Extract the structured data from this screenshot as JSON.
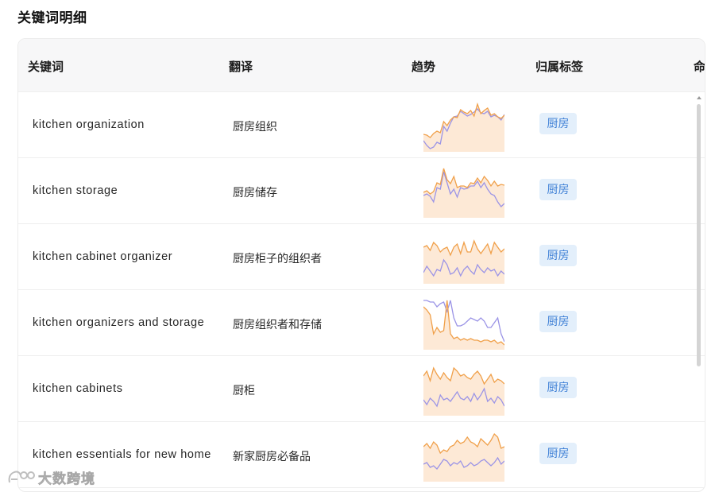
{
  "page_title": "关键词明细",
  "columns": [
    "关键词",
    "翻译",
    "趋势",
    "归属标签",
    "命"
  ],
  "rows": [
    {
      "keyword": "kitchen organization",
      "translation": "厨房组织",
      "tag": "厨房",
      "trend_orange": [
        22,
        21,
        18,
        23,
        26,
        24,
        38,
        33,
        40,
        44,
        43,
        53,
        50,
        48,
        52,
        45,
        60,
        48,
        52,
        55,
        46,
        48,
        44,
        42,
        46
      ],
      "trend_purple": [
        14,
        8,
        4,
        6,
        12,
        10,
        32,
        26,
        36,
        44,
        45,
        51,
        48,
        45,
        47,
        50,
        54,
        49,
        48,
        51,
        44,
        46,
        44,
        40,
        47
      ]
    },
    {
      "keyword": "kitchen storage",
      "translation": "厨房储存",
      "tag": "厨房",
      "trend_orange": [
        32,
        34,
        30,
        33,
        44,
        42,
        62,
        48,
        43,
        52,
        38,
        40,
        40,
        38,
        44,
        43,
        50,
        44,
        52,
        47,
        40,
        46,
        40,
        42,
        41
      ],
      "trend_purple": [
        28,
        30,
        27,
        20,
        38,
        36,
        58,
        44,
        30,
        36,
        26,
        38,
        36,
        37,
        40,
        40,
        46,
        38,
        44,
        36,
        30,
        28,
        20,
        14,
        18
      ]
    },
    {
      "keyword": "kitchen cabinet organizer",
      "translation": "厨房柜子的组织者",
      "tag": "厨房",
      "trend_orange": [
        46,
        48,
        42,
        52,
        48,
        40,
        44,
        46,
        36,
        46,
        50,
        38,
        52,
        40,
        40,
        54,
        44,
        38,
        44,
        50,
        38,
        52,
        46,
        40,
        44
      ],
      "trend_purple": [
        14,
        22,
        16,
        10,
        18,
        16,
        30,
        24,
        12,
        14,
        20,
        10,
        18,
        22,
        16,
        12,
        24,
        18,
        14,
        20,
        16,
        18,
        10,
        16,
        12
      ]
    },
    {
      "keyword": "kitchen organizers and storage",
      "translation": "厨房组织者和存储",
      "tag": "厨房",
      "trend_orange": [
        54,
        50,
        44,
        20,
        28,
        22,
        24,
        62,
        20,
        14,
        16,
        12,
        14,
        12,
        14,
        12,
        12,
        10,
        12,
        12,
        10,
        12,
        8,
        10,
        6
      ],
      "trend_purple": [
        62,
        62,
        60,
        60,
        54,
        58,
        60,
        48,
        62,
        40,
        30,
        30,
        32,
        36,
        40,
        38,
        36,
        40,
        36,
        28,
        28,
        34,
        40,
        20,
        10
      ]
    },
    {
      "keyword": "kitchen cabinets",
      "translation": "厨柜",
      "tag": "厨房",
      "trend_orange": [
        50,
        56,
        44,
        60,
        52,
        46,
        54,
        48,
        44,
        60,
        56,
        50,
        52,
        48,
        46,
        52,
        56,
        50,
        40,
        46,
        52,
        42,
        46,
        44,
        40
      ],
      "trend_purple": [
        20,
        14,
        22,
        18,
        12,
        26,
        20,
        22,
        18,
        24,
        30,
        22,
        20,
        24,
        18,
        28,
        20,
        26,
        34,
        18,
        22,
        16,
        24,
        20,
        12
      ],
      "_": ""
    },
    {
      "keyword": "kitchen essentials for new home",
      "translation": "新家厨房必备品",
      "tag": "厨房",
      "trend_orange": [
        44,
        48,
        42,
        50,
        46,
        36,
        40,
        38,
        44,
        46,
        52,
        48,
        50,
        56,
        50,
        48,
        44,
        54,
        50,
        46,
        52,
        60,
        56,
        42,
        44
      ],
      "trend_purple": [
        22,
        24,
        18,
        20,
        16,
        22,
        28,
        26,
        20,
        24,
        22,
        26,
        18,
        20,
        24,
        20,
        22,
        26,
        28,
        24,
        20,
        24,
        30,
        22,
        26
      ]
    }
  ],
  "colors": {
    "orange_line": "#f0a04a",
    "orange_fill": "#fde9d6",
    "purple_line": "#9b94e6",
    "tag_bg": "#e3effb",
    "tag_text": "#3f80d6"
  },
  "watermark": "大数跨境"
}
